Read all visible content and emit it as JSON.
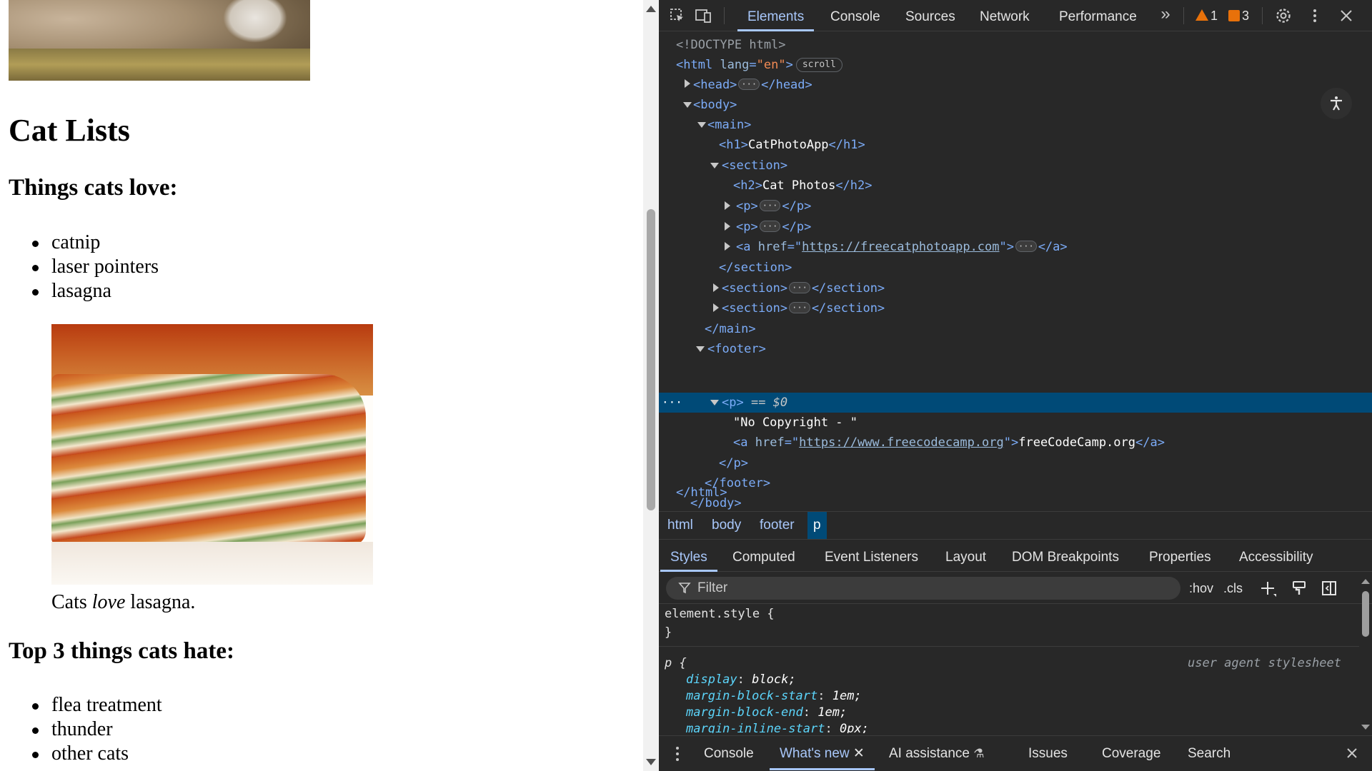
{
  "page": {
    "heading": "Cat Lists",
    "love_heading": "Things cats love:",
    "love_items": [
      "catnip",
      "laser pointers",
      "lasagna"
    ],
    "caption_prefix": "Cats ",
    "caption_em": "love",
    "caption_suffix": " lasagna.",
    "hate_heading": "Top 3 things cats hate:",
    "hate_items": [
      "flea treatment",
      "thunder",
      "other cats"
    ]
  },
  "devtools": {
    "tabs": [
      "Elements",
      "Console",
      "Sources",
      "Network",
      "Performance"
    ],
    "active_tab": "Elements",
    "more_tabs": "»",
    "warnings_count": "1",
    "errors_count": "3",
    "dom": {
      "doctype": "<!DOCTYPE html>",
      "html_open_tag": "<html",
      "lang_attr": "lang",
      "lang_val": "\"en\"",
      "scroll_badge": "scroll",
      "head_open": "<head>",
      "head_close": "</head>",
      "body_open": "<body>",
      "main_open": "<main>",
      "h1_open": "<h1>",
      "h1_text": "CatPhotoApp",
      "h1_close": "</h1>",
      "section_open": "<section>",
      "h2_open": "<h2>",
      "h2_text": "Cat Photos",
      "h2_close": "</h2>",
      "p_open": "<p>",
      "p_close": "</p>",
      "a_open": "<a",
      "href_attr": "href",
      "catphoto_url": "https://freecatphotoapp.com",
      "a_close": "</a>",
      "section_close": "</section>",
      "main_close": "</main>",
      "footer_open": "<footer>",
      "selected_p": "<p>",
      "dollar_zero": "== $0",
      "copyright_text": "\"No Copyright - \"",
      "fcc_url": "https://www.freecodecamp.org",
      "fcc_text": "freeCodeCamp.org",
      "footer_close": "</footer>",
      "body_close": "</body>",
      "html_close": "</html>",
      "ellipsis": "···"
    },
    "breadcrumb": [
      "html",
      "body",
      "footer",
      "p"
    ],
    "styles_tabs": [
      "Styles",
      "Computed",
      "Event Listeners",
      "Layout",
      "DOM Breakpoints",
      "Properties",
      "Accessibility"
    ],
    "filter_placeholder": "Filter",
    "hov_label": ":hov",
    "cls_label": ".cls",
    "styles": {
      "element_style_open": "element.style {",
      "close_brace": "}",
      "p_selector": "p {",
      "ua_label": "user agent stylesheet",
      "rules": [
        {
          "prop": "display",
          "val": "block;"
        },
        {
          "prop": "margin-block-start",
          "val": "1em;"
        },
        {
          "prop": "margin-block-end",
          "val": "1em;"
        },
        {
          "prop": "margin-inline-start",
          "val": "0px;"
        }
      ]
    },
    "drawer_tabs": [
      "Console",
      "What's new",
      "AI assistance",
      "Issues",
      "Coverage",
      "Search"
    ],
    "active_drawer_tab": "What's new"
  },
  "colors": {
    "accent": "#a8c7fa",
    "selection": "#004a77",
    "tag": "#7cacf8",
    "attr_value": "#f28b54",
    "warning": "#e8710a"
  },
  "icons": [
    "inspect-icon",
    "device-toolbar-icon",
    "more-tabs-icon",
    "warning-icon",
    "error-icon",
    "settings-icon",
    "kebab-menu-icon",
    "close-icon",
    "accessibility-icon",
    "filter-icon",
    "add-rule-icon",
    "paint-icon",
    "sidebar-toggle-icon",
    "experiment-icon"
  ]
}
